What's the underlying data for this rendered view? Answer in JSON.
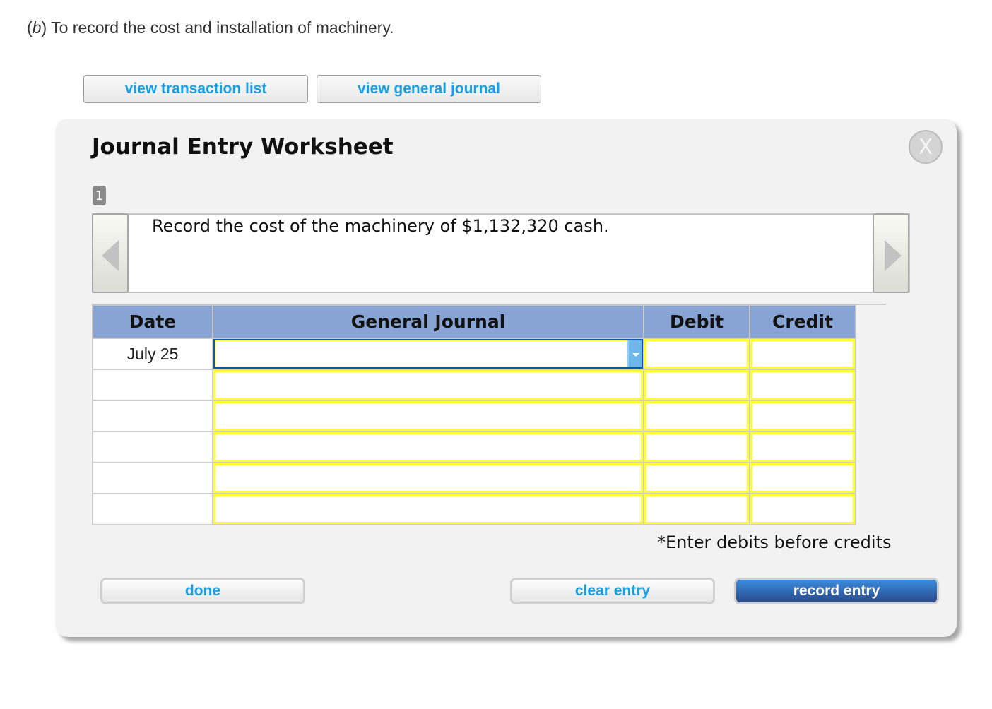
{
  "instruction": {
    "label": "b",
    "text": " To record the cost and installation of machinery."
  },
  "top_buttons": {
    "transaction_list": "view transaction list",
    "general_journal": "view general journal"
  },
  "worksheet": {
    "title": "Journal Entry Worksheet",
    "close_glyph": "X",
    "page_number": "1",
    "description": "Record the cost of the machinery of $1,132,320 cash.",
    "columns": [
      "Date",
      "General Journal",
      "Debit",
      "Credit"
    ],
    "rows": [
      {
        "date": "July 25",
        "account": "",
        "debit": "",
        "credit": ""
      },
      {
        "date": "",
        "account": "",
        "debit": "",
        "credit": ""
      },
      {
        "date": "",
        "account": "",
        "debit": "",
        "credit": ""
      },
      {
        "date": "",
        "account": "",
        "debit": "",
        "credit": ""
      },
      {
        "date": "",
        "account": "",
        "debit": "",
        "credit": ""
      },
      {
        "date": "",
        "account": "",
        "debit": "",
        "credit": ""
      }
    ],
    "note": "*Enter debits before credits",
    "buttons": {
      "done": "done",
      "clear": "clear entry",
      "record": "record entry"
    }
  },
  "colors": {
    "link_blue": "#16a0e6",
    "header_blue": "#88a4d4",
    "input_border_yellow": "#ffff30",
    "primary_button": "#2e5da5"
  }
}
